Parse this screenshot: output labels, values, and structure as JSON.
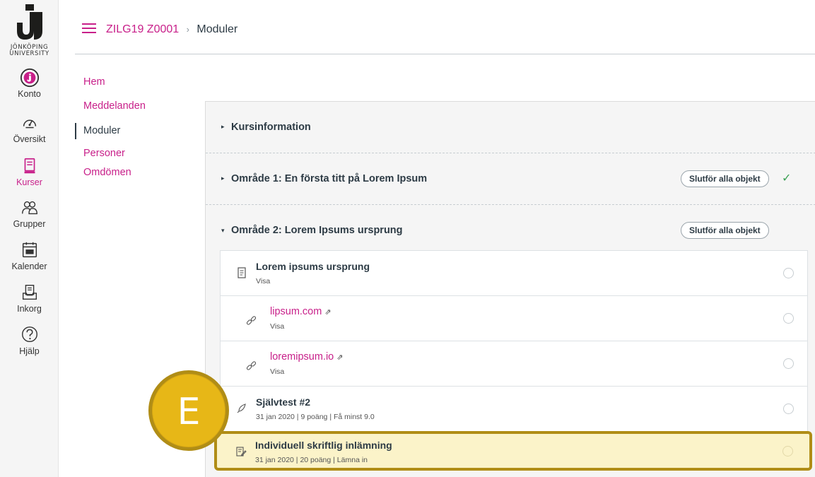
{
  "brand": {
    "logo_text_line1": "JÖNKÖPING",
    "logo_text_line2": "UNIVERSITY",
    "accent_color": "#c8208a",
    "highlight_color": "#b08d16"
  },
  "global_nav": [
    {
      "label": "Konto",
      "icon": "account-avatar-icon"
    },
    {
      "label": "Översikt",
      "icon": "dashboard-gauge-icon"
    },
    {
      "label": "Kurser",
      "icon": "courses-book-icon",
      "active": true
    },
    {
      "label": "Grupper",
      "icon": "groups-people-icon"
    },
    {
      "label": "Kalender",
      "icon": "calendar-icon"
    },
    {
      "label": "Inkorg",
      "icon": "inbox-icon"
    },
    {
      "label": "Hjälp",
      "icon": "help-question-icon"
    }
  ],
  "breadcrumb": {
    "course": "ZILG19 Z0001",
    "separator": "›",
    "current": "Moduler"
  },
  "course_nav": [
    {
      "label": "Hem"
    },
    {
      "label": "Meddelanden"
    },
    {
      "label": "Moduler",
      "active": true
    },
    {
      "label": "Personer"
    },
    {
      "label": "Omdömen"
    }
  ],
  "modules": [
    {
      "title": "Kursinformation",
      "collapsed": true
    },
    {
      "title": "Område 1: En första titt på Lorem Ipsum",
      "collapsed": true,
      "requirement": "Slutför alla objekt",
      "completed": true
    },
    {
      "title": "Område 2: Lorem Ipsums ursprung",
      "collapsed": false,
      "requirement": "Slutför alla objekt"
    }
  ],
  "items": [
    {
      "title": "Lorem ipsums ursprung",
      "meta": "Visa",
      "icon": "page-icon",
      "link": false,
      "indent": 0
    },
    {
      "title": "lipsum.com",
      "meta": "Visa",
      "icon": "link-icon",
      "link": true,
      "indent": 1,
      "external": true
    },
    {
      "title": "loremipsum.io",
      "meta": "Visa",
      "icon": "link-icon",
      "link": true,
      "indent": 1,
      "external": true
    },
    {
      "title": "Självtest #2",
      "meta": "31 jan 2020 | 9 poäng | Få minst 9.0",
      "icon": "quiz-rocket-icon",
      "link": false,
      "indent": 0
    },
    {
      "title": "Individuell skriftlig inlämning",
      "meta": "31 jan 2020 | 20 poäng | Lämna in",
      "icon": "assignment-icon",
      "link": false,
      "indent": 0,
      "highlighted": true
    }
  ],
  "badge": {
    "letter": "E"
  }
}
